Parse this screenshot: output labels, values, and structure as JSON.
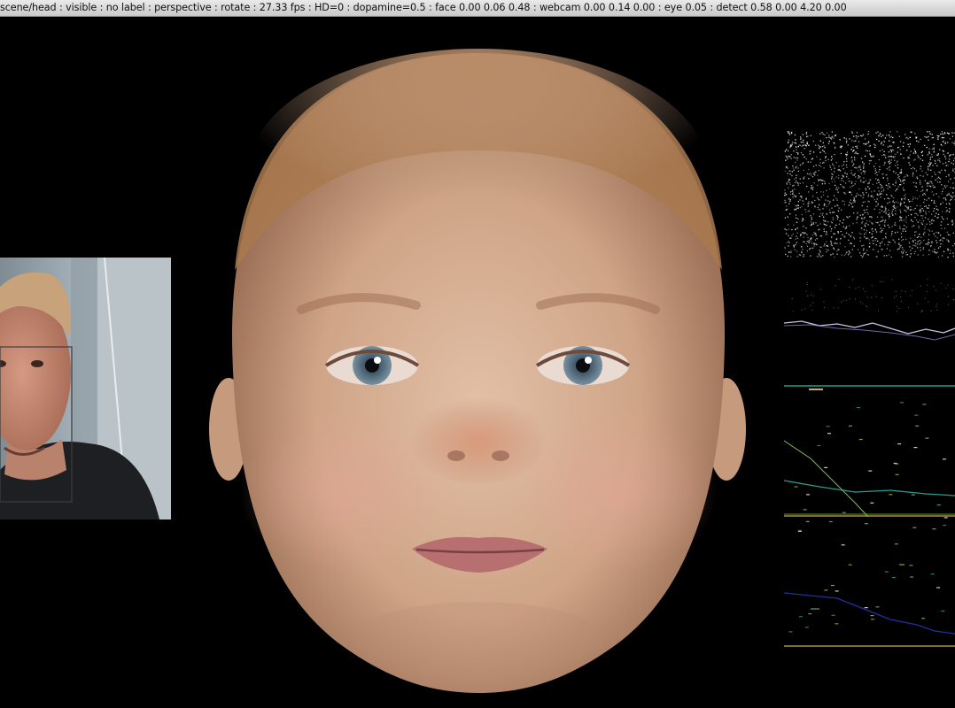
{
  "status_bar": {
    "text": "scene/head : visible : no label : perspective : rotate : 27.33 fps : HD=0 : dopamine=0.5 : face  0.00  0.06  0.48 : webcam  0.00 0.14 0.00 : eye 0.05 : detect  0.58  0.00  4.20  0.00"
  },
  "colors": {
    "background": "#000000",
    "skin": "#d9b297",
    "hair": "#a5744f",
    "iris": "#5b7487",
    "plot_teal": "#2a9c8e",
    "plot_yellow": "#c9b04a",
    "plot_green": "#7fbf4a",
    "plot_blue": "#2030a0"
  },
  "webcam_feed": {
    "icon": "webcam-feed-image",
    "has_face_box": true
  },
  "avatar": {
    "icon": "baby-face-render"
  },
  "plots": {
    "icon": "neural-activity-plots"
  }
}
